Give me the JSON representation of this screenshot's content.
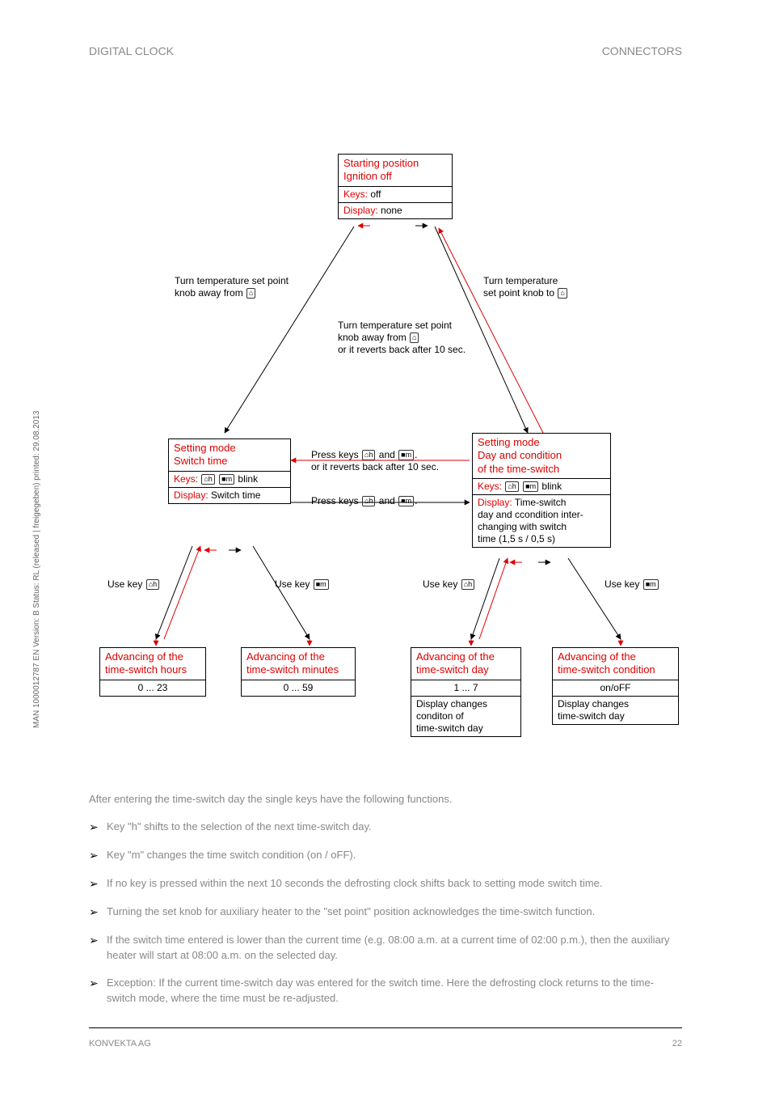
{
  "vertical": "MAN  1000012787  EN  Version: B  Status: RL (released | freigegeben)  printed: 29.08.2013",
  "top_left": "DIGITAL CLOCK",
  "top_right": "CONNECTORS",
  "flow": {
    "start": {
      "title": "Starting position\nIgnition off",
      "keys": "Keys:",
      "keys_v": " off",
      "disp": "Display:",
      "disp_v": " none"
    },
    "lbl_left": "Turn temperature set point\nknob away from ",
    "lbl_right": "Turn temperature\nset point knob to ",
    "lbl_mid": "Turn temperature set point\nknob away from \nor it reverts back after 10 sec.",
    "sm_switch": {
      "title": "Setting mode\nSwitch time",
      "keys": "Keys:",
      "keys_v": " blink",
      "disp": "Display:",
      "disp_v": " Switch time"
    },
    "sm_day": {
      "title": "Setting mode\nDay and condition\nof the time-switch",
      "keys": "Keys:",
      "keys_v": " blink",
      "disp": "Display:",
      "disp_v": " Time-switch\nday and ccondition inter-\nchanging with switch\ntime  (1,5 s / 0,5 s)"
    },
    "press_or": "Press keys       and       .\nor it reverts back after 10 sec.",
    "press": "Press keys       and       .",
    "use_h": "Use key ",
    "use_m": "Use key ",
    "use_dh": "Use key ",
    "use_dm": "Use key ",
    "adv_h": {
      "t": "Advancing of the\ntime-switch hours",
      "r": "0 ... 23"
    },
    "adv_m": {
      "t": "Advancing of the\ntime-switch minutes",
      "r": "0 ... 59"
    },
    "adv_d": {
      "t": "Advancing of the\ntime-switch day",
      "r": "1 ... 7",
      "sub": "Display changes\nconditon of\ntime-switch day"
    },
    "adv_c": {
      "t": "Advancing of the\ntime-switch condition",
      "r": "on/oFF",
      "sub": "Display changes\ntime-switch day"
    }
  },
  "para1": "After entering the time-switch day the single keys have the following functions.",
  "bullets": [
    "Key \"h\" shifts to the selection of the next time-switch day.",
    "Key \"m\" changes the time switch condition (on / oFF).",
    "If no key is pressed within the next 10 seconds the defrosting clock shifts back to setting mode switch time.",
    "Turning the set knob for auxiliary heater to the \"set point\" position acknowledges the time-switch function.",
    "If the switch time entered is lower than the current time (e.g. 08:00 a.m. at a current time of 02:00 p.m.), then the auxiliary heater will start at 08:00 a.m. on the selected day.",
    "Exception: If the current time-switch day was entered for the switch time. Here the defrosting clock returns to the time-switch mode, where the time must be re-adjusted."
  ],
  "footer_left": "KONVEKTA AG",
  "footer_right": "22"
}
